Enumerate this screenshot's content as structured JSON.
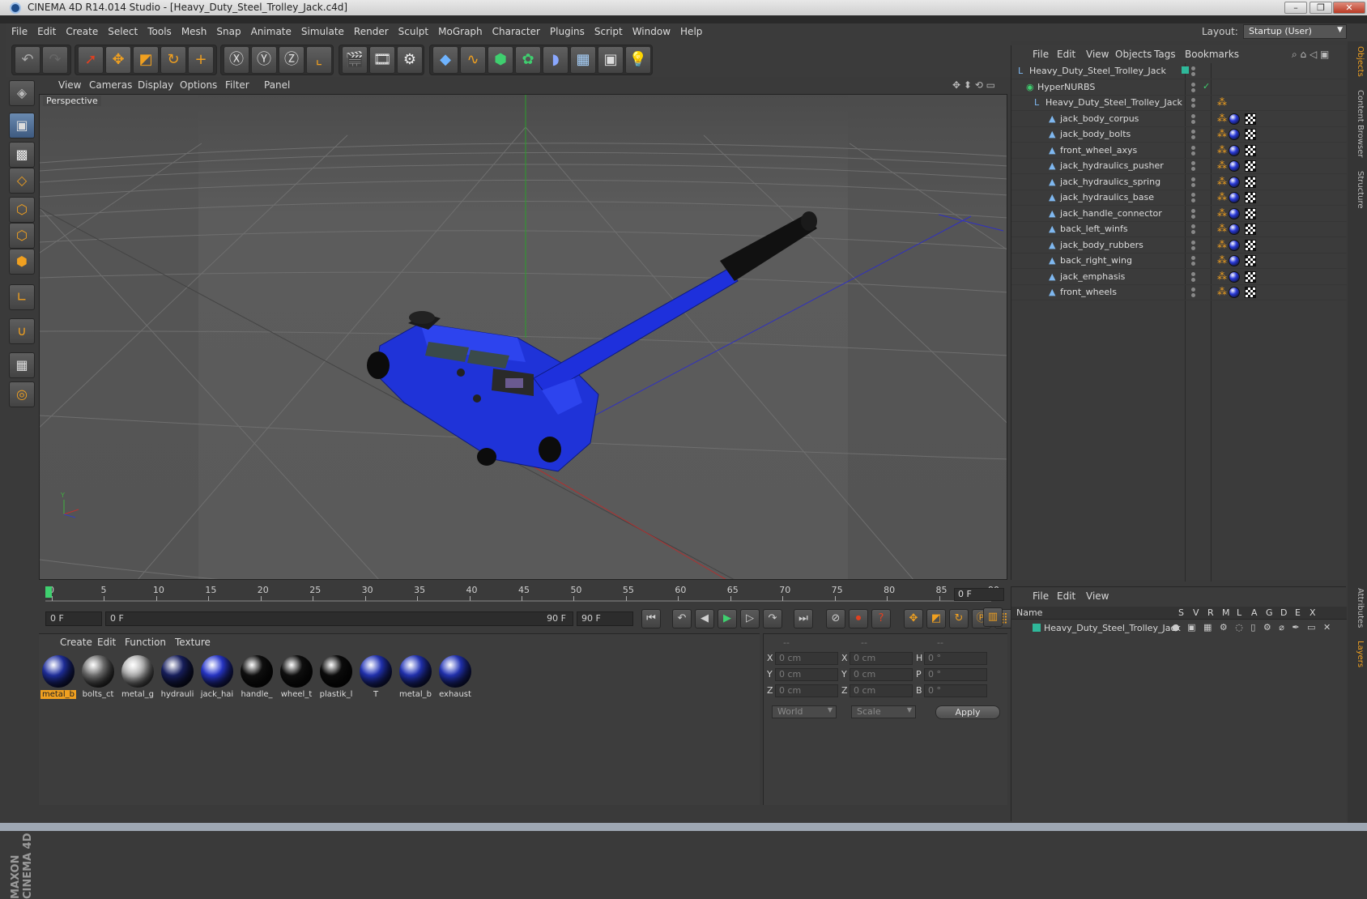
{
  "window": {
    "title": "CINEMA 4D R14.014 Studio - [Heavy_Duty_Steel_Trolley_Jack.c4d]"
  },
  "menu": [
    "File",
    "Edit",
    "Create",
    "Select",
    "Tools",
    "Mesh",
    "Snap",
    "Animate",
    "Simulate",
    "Render",
    "Sculpt",
    "MoGraph",
    "Character",
    "Plugins",
    "Script",
    "Window",
    "Help"
  ],
  "layout": {
    "label": "Layout:",
    "value": "Startup (User)"
  },
  "viewport": {
    "menu": [
      "View",
      "Cameras",
      "Display",
      "Options",
      "Filter",
      "Panel"
    ],
    "label": "Perspective"
  },
  "timeline": {
    "ticks": [
      "0",
      "5",
      "10",
      "15",
      "20",
      "25",
      "30",
      "35",
      "40",
      "45",
      "50",
      "55",
      "60",
      "65",
      "70",
      "75",
      "80",
      "85",
      "90"
    ],
    "current_frame": "0 F",
    "start_field": "0 F",
    "range_start": "0 F",
    "range_end": "90 F",
    "end_field": "90 F"
  },
  "materials": {
    "menu": [
      "Create",
      "Edit",
      "Function",
      "Texture"
    ],
    "items": [
      {
        "label": "metal_b",
        "color": "#2233aa",
        "selected": true
      },
      {
        "label": "bolts_ct",
        "color": "#777777",
        "selected": false
      },
      {
        "label": "metal_g",
        "color": "#bbbbbb",
        "selected": false
      },
      {
        "label": "hydrauli",
        "color": "#1a2266",
        "selected": false
      },
      {
        "label": "jack_hai",
        "color": "#2a3ad8",
        "selected": false
      },
      {
        "label": "handle_",
        "color": "#111111",
        "selected": false
      },
      {
        "label": "wheel_t",
        "color": "#111111",
        "selected": false
      },
      {
        "label": "plastik_l",
        "color": "#0d0d0d",
        "selected": false
      },
      {
        "label": "T",
        "color": "#2436c0",
        "selected": false
      },
      {
        "label": "metal_b",
        "color": "#2436c0",
        "selected": false
      },
      {
        "label": "exhaust",
        "color": "#2436c0",
        "selected": false
      }
    ]
  },
  "coords": {
    "headers": [
      "--",
      "--",
      "--"
    ],
    "rows": [
      {
        "a": "X",
        "av": "0 cm",
        "b": "X",
        "bv": "0 cm",
        "c": "H",
        "cv": "0 °"
      },
      {
        "a": "Y",
        "av": "0 cm",
        "b": "Y",
        "bv": "0 cm",
        "c": "P",
        "cv": "0 °"
      },
      {
        "a": "Z",
        "av": "0 cm",
        "b": "Z",
        "bv": "0 cm",
        "c": "B",
        "cv": "0 °"
      }
    ],
    "world": "World",
    "scale": "Scale",
    "apply": "Apply"
  },
  "objects": {
    "menu": [
      "File",
      "Edit",
      "View",
      "Objects",
      "Tags",
      "Bookmarks"
    ],
    "rows": [
      {
        "name": "Heavy_Duty_Steel_Trolley_Jack",
        "indent": 0
      },
      {
        "name": "HyperNURBS",
        "indent": 1
      },
      {
        "name": "Heavy_Duty_Steel_Trolley_Jack",
        "indent": 2
      },
      {
        "name": "jack_body_corpus",
        "indent": 3
      },
      {
        "name": "jack_body_bolts",
        "indent": 3
      },
      {
        "name": "front_wheel_axys",
        "indent": 3
      },
      {
        "name": "jack_hydraulics_pusher",
        "indent": 3
      },
      {
        "name": "jack_hydraulics_spring",
        "indent": 3
      },
      {
        "name": "jack_hydraulics_base",
        "indent": 3
      },
      {
        "name": "jack_handle_connector",
        "indent": 3
      },
      {
        "name": "back_left_winfs",
        "indent": 3
      },
      {
        "name": "jack_body_rubbers",
        "indent": 3
      },
      {
        "name": "back_right_wing",
        "indent": 3
      },
      {
        "name": "jack_emphasis",
        "indent": 3
      },
      {
        "name": "front_wheels",
        "indent": 3
      }
    ]
  },
  "layers": {
    "menu": [
      "File",
      "Edit",
      "View"
    ],
    "header_name": "Name",
    "flags": [
      "S",
      "V",
      "R",
      "M",
      "L",
      "A",
      "G",
      "D",
      "E",
      "X"
    ],
    "row": "Heavy_Duty_Steel_Trolley_Jack"
  },
  "right_tabs": [
    "Objects",
    "Content Browser",
    "Structure",
    "Attributes",
    "Layers"
  ],
  "brand": "MAXON CINEMA 4D",
  "accent": "#f0a020"
}
